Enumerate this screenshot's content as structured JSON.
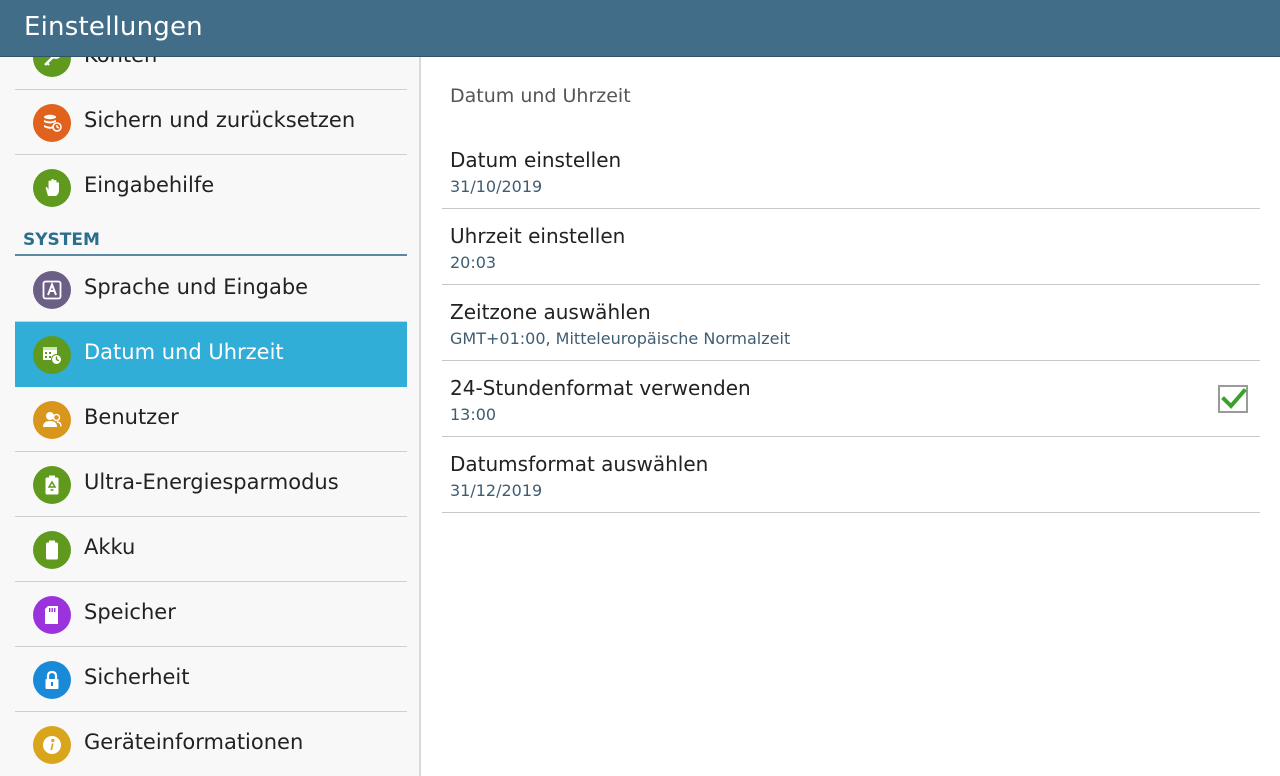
{
  "app": {
    "title": "Einstellungen"
  },
  "sidebar": {
    "items": [
      {
        "label": "Konten",
        "icon": "key-icon",
        "color": "#5f9a1e"
      },
      {
        "label": "Sichern und zurücksetzen",
        "icon": "backup-icon",
        "color": "#e0621c"
      },
      {
        "label": "Eingabehilfe",
        "icon": "hand-icon",
        "color": "#5f9a1e"
      }
    ],
    "section": "SYSTEM",
    "system_items": [
      {
        "label": "Sprache und Eingabe",
        "icon": "language-icon",
        "color": "#6c5f86"
      },
      {
        "label": "Datum und Uhrzeit",
        "icon": "calendar-clock-icon",
        "color": "#5f9a1e",
        "selected": true
      },
      {
        "label": "Benutzer",
        "icon": "users-icon",
        "color": "#d9961c"
      },
      {
        "label": "Ultra-Energiesparmodus",
        "icon": "battery-recycle-icon",
        "color": "#5f9a1e"
      },
      {
        "label": "Akku",
        "icon": "battery-icon",
        "color": "#5f9a1e"
      },
      {
        "label": "Speicher",
        "icon": "sd-card-icon",
        "color": "#9b33dd"
      },
      {
        "label": "Sicherheit",
        "icon": "lock-icon",
        "color": "#1a8ad8"
      },
      {
        "label": "Geräteinformationen",
        "icon": "info-icon",
        "color": "#d9a51c"
      }
    ]
  },
  "main": {
    "title": "Datum und Uhrzeit",
    "rows": [
      {
        "title": "Datum einstellen",
        "sub": "31/10/2019"
      },
      {
        "title": "Uhrzeit einstellen",
        "sub": "20:03"
      },
      {
        "title": "Zeitzone auswählen",
        "sub": "GMT+01:00, Mitteleuropäische Normalzeit"
      },
      {
        "title": "24-Stundenformat verwenden",
        "sub": "13:00",
        "checked": true
      },
      {
        "title": "Datumsformat auswählen",
        "sub": "31/12/2019"
      }
    ]
  },
  "colors": {
    "topbar": "#426d89",
    "selected": "#31aed8",
    "section": "#2c6f8c",
    "check": "#3aa12b"
  }
}
